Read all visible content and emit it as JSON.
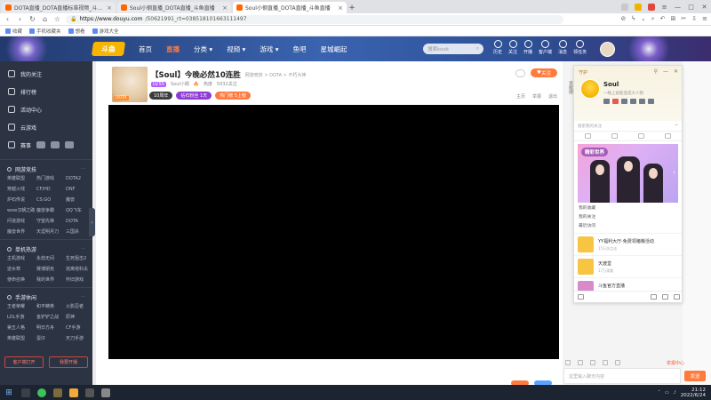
{
  "browser": {
    "tabs": [
      {
        "title": "DOTA直播_DOTA直播标准视频_斗鱼直播",
        "active": false
      },
      {
        "title": "Soul小钢直播_DOTA直播_斗鱼直播",
        "active": false
      },
      {
        "title": "Soul小钢直播_DOTA直播_斗鱼直播",
        "active": true
      }
    ],
    "url_host": "https://www.douyu.com",
    "url_path": "/50621991_rt=038518101663111497",
    "bookmarks": [
      "收藏",
      "手机收藏夹",
      "想看",
      "游戏大全"
    ]
  },
  "site": {
    "logo_text": "斗鱼",
    "nav": [
      {
        "label": "首页",
        "active": false
      },
      {
        "label": "直播",
        "active": true
      },
      {
        "label": "分类",
        "active": false
      },
      {
        "label": "视频",
        "active": false
      },
      {
        "label": "游戏",
        "active": false
      },
      {
        "label": "鱼吧",
        "active": false
      },
      {
        "label": "星城崛起",
        "active": false
      }
    ],
    "search_placeholder": "搜索kook",
    "header_icons": [
      {
        "name": "history",
        "label": "历史"
      },
      {
        "name": "follow",
        "label": "关注"
      },
      {
        "name": "broadcast",
        "label": "开播"
      },
      {
        "name": "client",
        "label": "客户端"
      },
      {
        "name": "message",
        "label": "消息"
      },
      {
        "name": "task",
        "label": "领任务"
      }
    ]
  },
  "sidebar": {
    "top_items": [
      {
        "icon": "heart",
        "label": "我的关注"
      },
      {
        "icon": "rank",
        "label": "排行榜"
      },
      {
        "icon": "event",
        "label": "活动中心"
      },
      {
        "icon": "cloud-game",
        "label": "云游戏"
      }
    ],
    "bottom_label": "赛事",
    "sections": [
      {
        "title": "网游竞技",
        "items": [
          "英雄联盟",
          "热门游戏",
          "DOTA2",
          "穿越火线",
          "CF/HD",
          "DNF",
          "炉石传说",
          "CS:GO",
          "魔兽",
          "wow汉朝之路",
          "魔兽争霸",
          "QQ飞车",
          "问道游戏",
          "守望先锋",
          "DOTA",
          "魔兽世界",
          "天涯明月刀",
          "三国杀"
        ]
      },
      {
        "title": "单机热游",
        "items": [
          "主机游戏",
          "永劫无间",
          "生死狙击2",
          "逆水寒",
          "赛博朋克",
          "逃离塔科夫",
          "使命召唤",
          "我的世界",
          "怀旧游戏"
        ]
      },
      {
        "title": "手游休闲",
        "items": [
          "王者荣耀",
          "和平精英",
          "火影忍者",
          "LOL手游",
          "金铲铲之战",
          "原神",
          "第五人格",
          "明日方舟",
          "CF手游",
          "英雄联盟",
          "蛋仔",
          "天刀手游"
        ]
      }
    ],
    "bottom_buttons": [
      "客户端打开",
      "我要开播"
    ]
  },
  "room": {
    "title": "【Soul】今晚必然10连胜",
    "category": "DOTA",
    "breadcrumb": "网游竞技 > DOTA > 不朽大神",
    "anchor_level": "LV.55",
    "anchor_name": "Soul小钢",
    "hot": "热度",
    "fans": "5032关注",
    "badges": [
      "10周年",
      "钻石粉丝 1天",
      "热门榜 5上榜"
    ],
    "follow_label": "关注",
    "tools": [
      "主页",
      "举报",
      "退出"
    ]
  },
  "chat": {
    "input_placeholder": "这里输入聊天内容",
    "send_label": "发送",
    "report_label": "举报中心",
    "side_tab": "贡献榜"
  },
  "popup": {
    "level_text": "守护",
    "name": "Soul",
    "desc": "一晚上就能变成大人物",
    "search_placeholder": "搜索我的关注",
    "banner_title": "精彩世界",
    "links": [
      "我的收藏",
      "我的关注",
      "最近访问"
    ],
    "rooms": [
      {
        "title": "YY福利大厅-免费领猪粮活动",
        "sub": "15万次点击"
      },
      {
        "title": "天渡堂",
        "sub": "17万观看"
      },
      {
        "title": "斗鱼官方直播",
        "sub": "10万观看"
      }
    ]
  },
  "taskbar": {
    "time": "21:12",
    "date": "2022/6/24"
  }
}
